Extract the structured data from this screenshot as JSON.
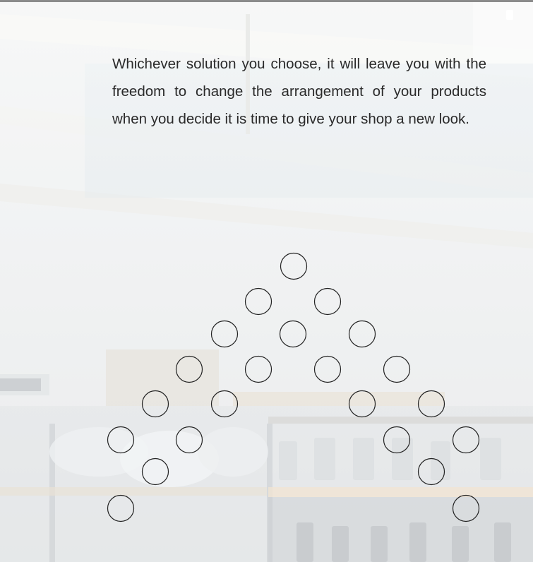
{
  "paragraph": {
    "text": "Whichever solution you choose, it will leave you with the freedom to change the arrangement of your products when you decide it is time to give your shop a new look."
  },
  "circle_pattern": {
    "rows": [
      {
        "count": 1
      },
      {
        "count": 2
      },
      {
        "count": 3
      },
      {
        "count": 4
      },
      {
        "count": 4
      },
      {
        "count": 4
      },
      {
        "count": 2
      },
      {
        "count": 2
      }
    ]
  },
  "colors": {
    "text": "#2a2a2a",
    "circle_stroke": "#222222",
    "top_bar": "#8b8b8b"
  }
}
